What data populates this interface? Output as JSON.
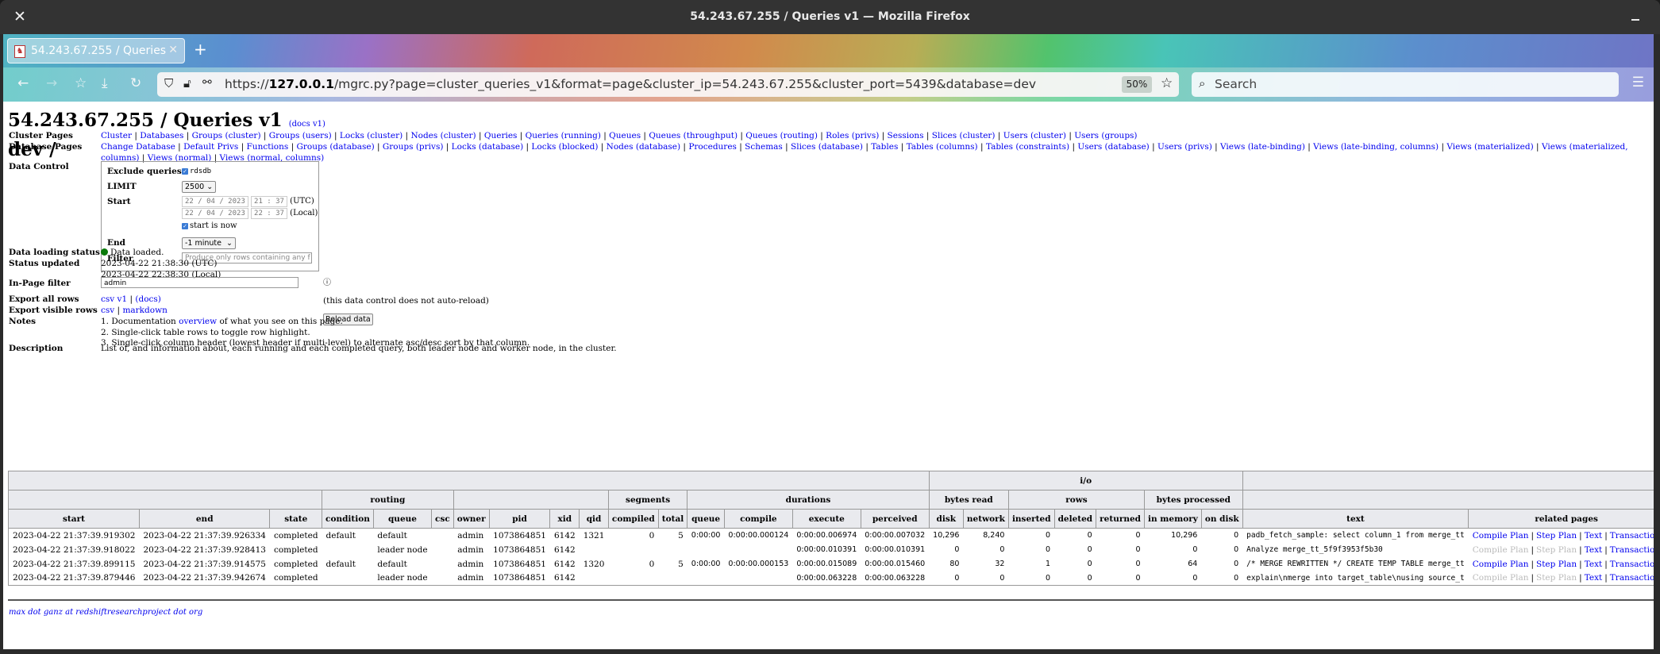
{
  "window": {
    "title": "54.243.67.255 / Queries v1 — Mozilla Firefox"
  },
  "browser": {
    "tab_title": "54.243.67.255 / Queries v1",
    "url_prefix": "https://",
    "url_host": "127.0.0.1",
    "url_rest": "/mgrc.py?page=cluster_queries_v1&format=page&cluster_ip=54.243.67.255&cluster_port=5439&database=dev",
    "zoom_level": "50%",
    "search_placeholder": "Search"
  },
  "page": {
    "title": "54.243.67.255 / Queries v1",
    "docs_link": "(docs v1)",
    "subtitle": "dev /",
    "cluster_pages_label": "Cluster Pages",
    "cluster_pages": [
      "Cluster",
      "Databases",
      "Groups (cluster)",
      "Groups (users)",
      "Locks (cluster)",
      "Nodes (cluster)",
      "Queries",
      "Queries (running)",
      "Queues",
      "Queues (throughput)",
      "Queues (routing)",
      "Roles (privs)",
      "Sessions",
      "Slices (cluster)",
      "Users (cluster)",
      "Users (groups)"
    ],
    "database_pages_label": "Database Pages",
    "database_pages": [
      "Change Database",
      "Default Privs",
      "Functions",
      "Groups (database)",
      "Groups (privs)",
      "Locks (database)",
      "Locks (blocked)",
      "Nodes (database)",
      "Procedures",
      "Schemas",
      "Slices (database)",
      "Tables",
      "Tables (columns)",
      "Tables (constraints)",
      "Users (database)",
      "Users (privs)",
      "Views (late-binding)",
      "Views (late-binding, columns)",
      "Views (materialized)",
      "Views (materialized, columns)",
      "Views (normal)",
      "Views (normal, columns)"
    ],
    "data_control": {
      "label": "Data Control",
      "exclude_label": "Exclude queries",
      "exclude_value": "rdsdb",
      "exclude_checked": true,
      "limit_label": "LIMIT",
      "limit_value": "2500",
      "start_label": "Start",
      "start_utc_date": "22 / 04 / 2023",
      "start_utc_time": "21 : 37",
      "utc_suffix": "(UTC)",
      "start_local_date": "22 / 04 / 2023",
      "start_local_time": "22 : 37",
      "local_suffix": "(Local)",
      "start_is_now_label": "start is now",
      "start_is_now_checked": true,
      "end_label": "End",
      "end_value": "-1 minute",
      "filter_label": "Filter",
      "filter_placeholder": "Produce only rows containing any f",
      "help_icon": "?",
      "note": "(this data control does not auto-reload)",
      "reload_button": "Reload data"
    },
    "status": {
      "loading_label": "Data loading status",
      "loading_value": "Data loaded.",
      "loading_color": "#0a7a0a",
      "updated_label": "Status updated",
      "updated_utc": "2023-04-22 21:38:30 (UTC)",
      "updated_local": "2023-04-22 22:38:30 (Local)"
    },
    "inpage_filter": {
      "label": "In-Page filter",
      "value": "admin"
    },
    "export_all": {
      "label": "Export all rows",
      "csv": "csv v1",
      "sep": "|",
      "docs": "(docs)"
    },
    "export_visible": {
      "label": "Export visible rows",
      "csv": "csv",
      "sep": "|",
      "markdown": "markdown"
    },
    "notes": {
      "label": "Notes",
      "n1_pre": "1. Documentation ",
      "n1_link": "overview",
      "n1_post": " of what you see on this page.",
      "n2": "2. Single-click table rows to toggle row highlight.",
      "n3": "3. Single-click column header (lowest header if multi-level) to alternate asc/desc sort by that column."
    },
    "description": {
      "label": "Description",
      "text": "List of, and information about, each running and each completed query, both leader node and worker node, in the cluster."
    },
    "footer": "max dot ganz at redshiftresearchproject dot org"
  },
  "table": {
    "group_top": {
      "io": "i/o"
    },
    "group_mid": {
      "routing": "routing",
      "segments": "segments",
      "durations": "durations",
      "bytes_read": "bytes read",
      "rows": "rows",
      "bytes_processed": "bytes processed"
    },
    "columns": [
      "start",
      "end",
      "state",
      "condition",
      "queue",
      "csc",
      "owner",
      "pid",
      "xid",
      "qid",
      "compiled",
      "total",
      "queue",
      "compile",
      "execute",
      "perceived",
      "disk",
      "network",
      "inserted",
      "deleted",
      "returned",
      "in memory",
      "on disk",
      "text",
      "related pages"
    ],
    "related_labels": {
      "compile_plan": "Compile Plan",
      "step_plan": "Step Plan",
      "text": "Text",
      "transaction": "Transaction",
      "sep": "|"
    },
    "rows": [
      {
        "start": "2023-04-22 21:37:39.919302",
        "end": "2023-04-22 21:37:39.926334",
        "state": "completed",
        "condition": "default",
        "queue": "default",
        "csc": "",
        "owner": "admin",
        "pid": "1073864851",
        "xid": "6142",
        "qid": "1321",
        "compiled": "0",
        "total": "5",
        "dqueue": "0:00:00",
        "compile": "0:00:00.000124",
        "execute": "0:00:00.006974",
        "perceived": "0:00:00.007032",
        "disk": "10,296",
        "network": "8,240",
        "inserted": "0",
        "deleted": "0",
        "returned": "0",
        "in_memory": "10,296",
        "on_disk": "0",
        "text": "padb_fetch_sample: select column_1 from merge_tt",
        "plans_enabled": true
      },
      {
        "start": "2023-04-22 21:37:39.918022",
        "end": "2023-04-22 21:37:39.928413",
        "state": "completed",
        "condition": "",
        "queue": "leader node",
        "csc": "",
        "owner": "admin",
        "pid": "1073864851",
        "xid": "6142",
        "qid": "",
        "compiled": "",
        "total": "",
        "dqueue": "",
        "compile": "",
        "execute": "0:00:00.010391",
        "perceived": "0:00:00.010391",
        "disk": "0",
        "network": "0",
        "inserted": "0",
        "deleted": "0",
        "returned": "0",
        "in_memory": "0",
        "on_disk": "0",
        "text": "Analyze merge_tt_5f9f3953f5b30",
        "plans_enabled": false
      },
      {
        "start": "2023-04-22 21:37:39.899115",
        "end": "2023-04-22 21:37:39.914575",
        "state": "completed",
        "condition": "default",
        "queue": "default",
        "csc": "",
        "owner": "admin",
        "pid": "1073864851",
        "xid": "6142",
        "qid": "1320",
        "compiled": "0",
        "total": "5",
        "dqueue": "0:00:00",
        "compile": "0:00:00.000153",
        "execute": "0:00:00.015089",
        "perceived": "0:00:00.015460",
        "disk": "80",
        "network": "32",
        "inserted": "1",
        "deleted": "0",
        "returned": "0",
        "in_memory": "64",
        "on_disk": "0",
        "text": "/* MERGE REWRITTEN */ CREATE TEMP TABLE merge_tt",
        "plans_enabled": true
      },
      {
        "start": "2023-04-22 21:37:39.879446",
        "end": "2023-04-22 21:37:39.942674",
        "state": "completed",
        "condition": "",
        "queue": "leader node",
        "csc": "",
        "owner": "admin",
        "pid": "1073864851",
        "xid": "6142",
        "qid": "",
        "compiled": "",
        "total": "",
        "dqueue": "",
        "compile": "",
        "execute": "0:00:00.063228",
        "perceived": "0:00:00.063228",
        "disk": "0",
        "network": "0",
        "inserted": "0",
        "deleted": "0",
        "returned": "0",
        "in_memory": "0",
        "on_disk": "0",
        "text": "explain\\nmerge into target_table\\nusing source_t",
        "plans_enabled": false
      }
    ]
  }
}
